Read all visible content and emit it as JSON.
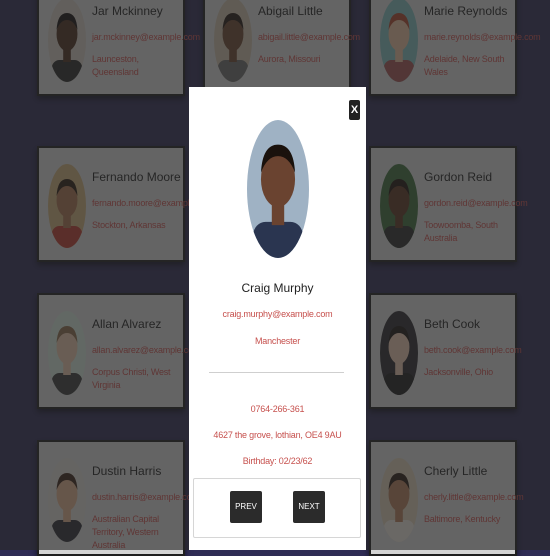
{
  "cards": [
    {
      "name": "Jar Mckinney",
      "email": "jar.mckinney@example.com",
      "location": "Launceston, Queensland",
      "skin": "#4a2e1e",
      "hair": "#151010",
      "bg": "#cfc6bd",
      "shirt": "#2a2a2a"
    },
    {
      "name": "Abigail Little",
      "email": "abigail.little@example.com",
      "location": "Aurora, Missouri",
      "skin": "#6b4530",
      "hair": "#231712",
      "bg": "#c9bba6",
      "shirt": "#6a6a6a"
    },
    {
      "name": "Marie Reynolds",
      "email": "marie.reynolds@example.com",
      "location": "Adelaide, New South Wales",
      "skin": "#e3b99a",
      "hair": "#a8472d",
      "bg": "#7fb9b9",
      "shirt": "#a05050"
    },
    {
      "name": "Fernando Moore",
      "email": "fernando.moore@example.com",
      "location": "Stockton, Arkansas",
      "skin": "#a6714e",
      "hair": "#2a1a10",
      "bg": "#c8ab7a",
      "shirt": "#b83b2f"
    },
    {
      "name": "Gordon Reid",
      "email": "gordon.reid@example.com",
      "location": "Toowoomba, South Australia",
      "skin": "#5a3420",
      "hair": "#1d120c",
      "bg": "#3c6a3a",
      "shirt": "#2b2b2b"
    },
    {
      "name": "Allan Alvarez",
      "email": "allan.alvarez@example.com",
      "location": "Corpus Christi, West Virginia",
      "skin": "#e2c1a5",
      "hair": "#8a6a4a",
      "bg": "#cfe0d4",
      "shirt": "#3a3a3a"
    },
    {
      "name": "Beth Cook",
      "email": "beth.cook@example.com",
      "location": "Jacksonville, Ohio",
      "skin": "#e4c2ad",
      "hair": "#1a1413",
      "bg": "#2c2a2e",
      "shirt": "#1f1f1f"
    },
    {
      "name": "Dustin Harris",
      "email": "dustin.harris@example.com",
      "location": "Australian Capital Territory, Western Australia",
      "skin": "#d9ab89",
      "hair": "#3a2418",
      "bg": "#d8d4cd",
      "shirt": "#2c2c34"
    },
    {
      "name": "Cherly Little",
      "email": "cherly.little@example.com",
      "location": "Baltimore, Kentucky",
      "skin": "#b17c5a",
      "hair": "#2a1a12",
      "bg": "#d8c8b2",
      "shirt": "#e6e0d8"
    }
  ],
  "modal": {
    "close_label": "X",
    "name": "Craig Murphy",
    "email": "craig.murphy@example.com",
    "city": "Manchester",
    "phone": "0764-266-361",
    "address": "4627 the grove, lothian, OE4 9AU",
    "birthday": "Birthday: 02/23/62",
    "prev_label": "PREV",
    "next_label": "NEXT",
    "skin": "#6a4330",
    "hair": "#1a120d",
    "bg": "#9fb2c4",
    "shirt": "#2a3550"
  }
}
